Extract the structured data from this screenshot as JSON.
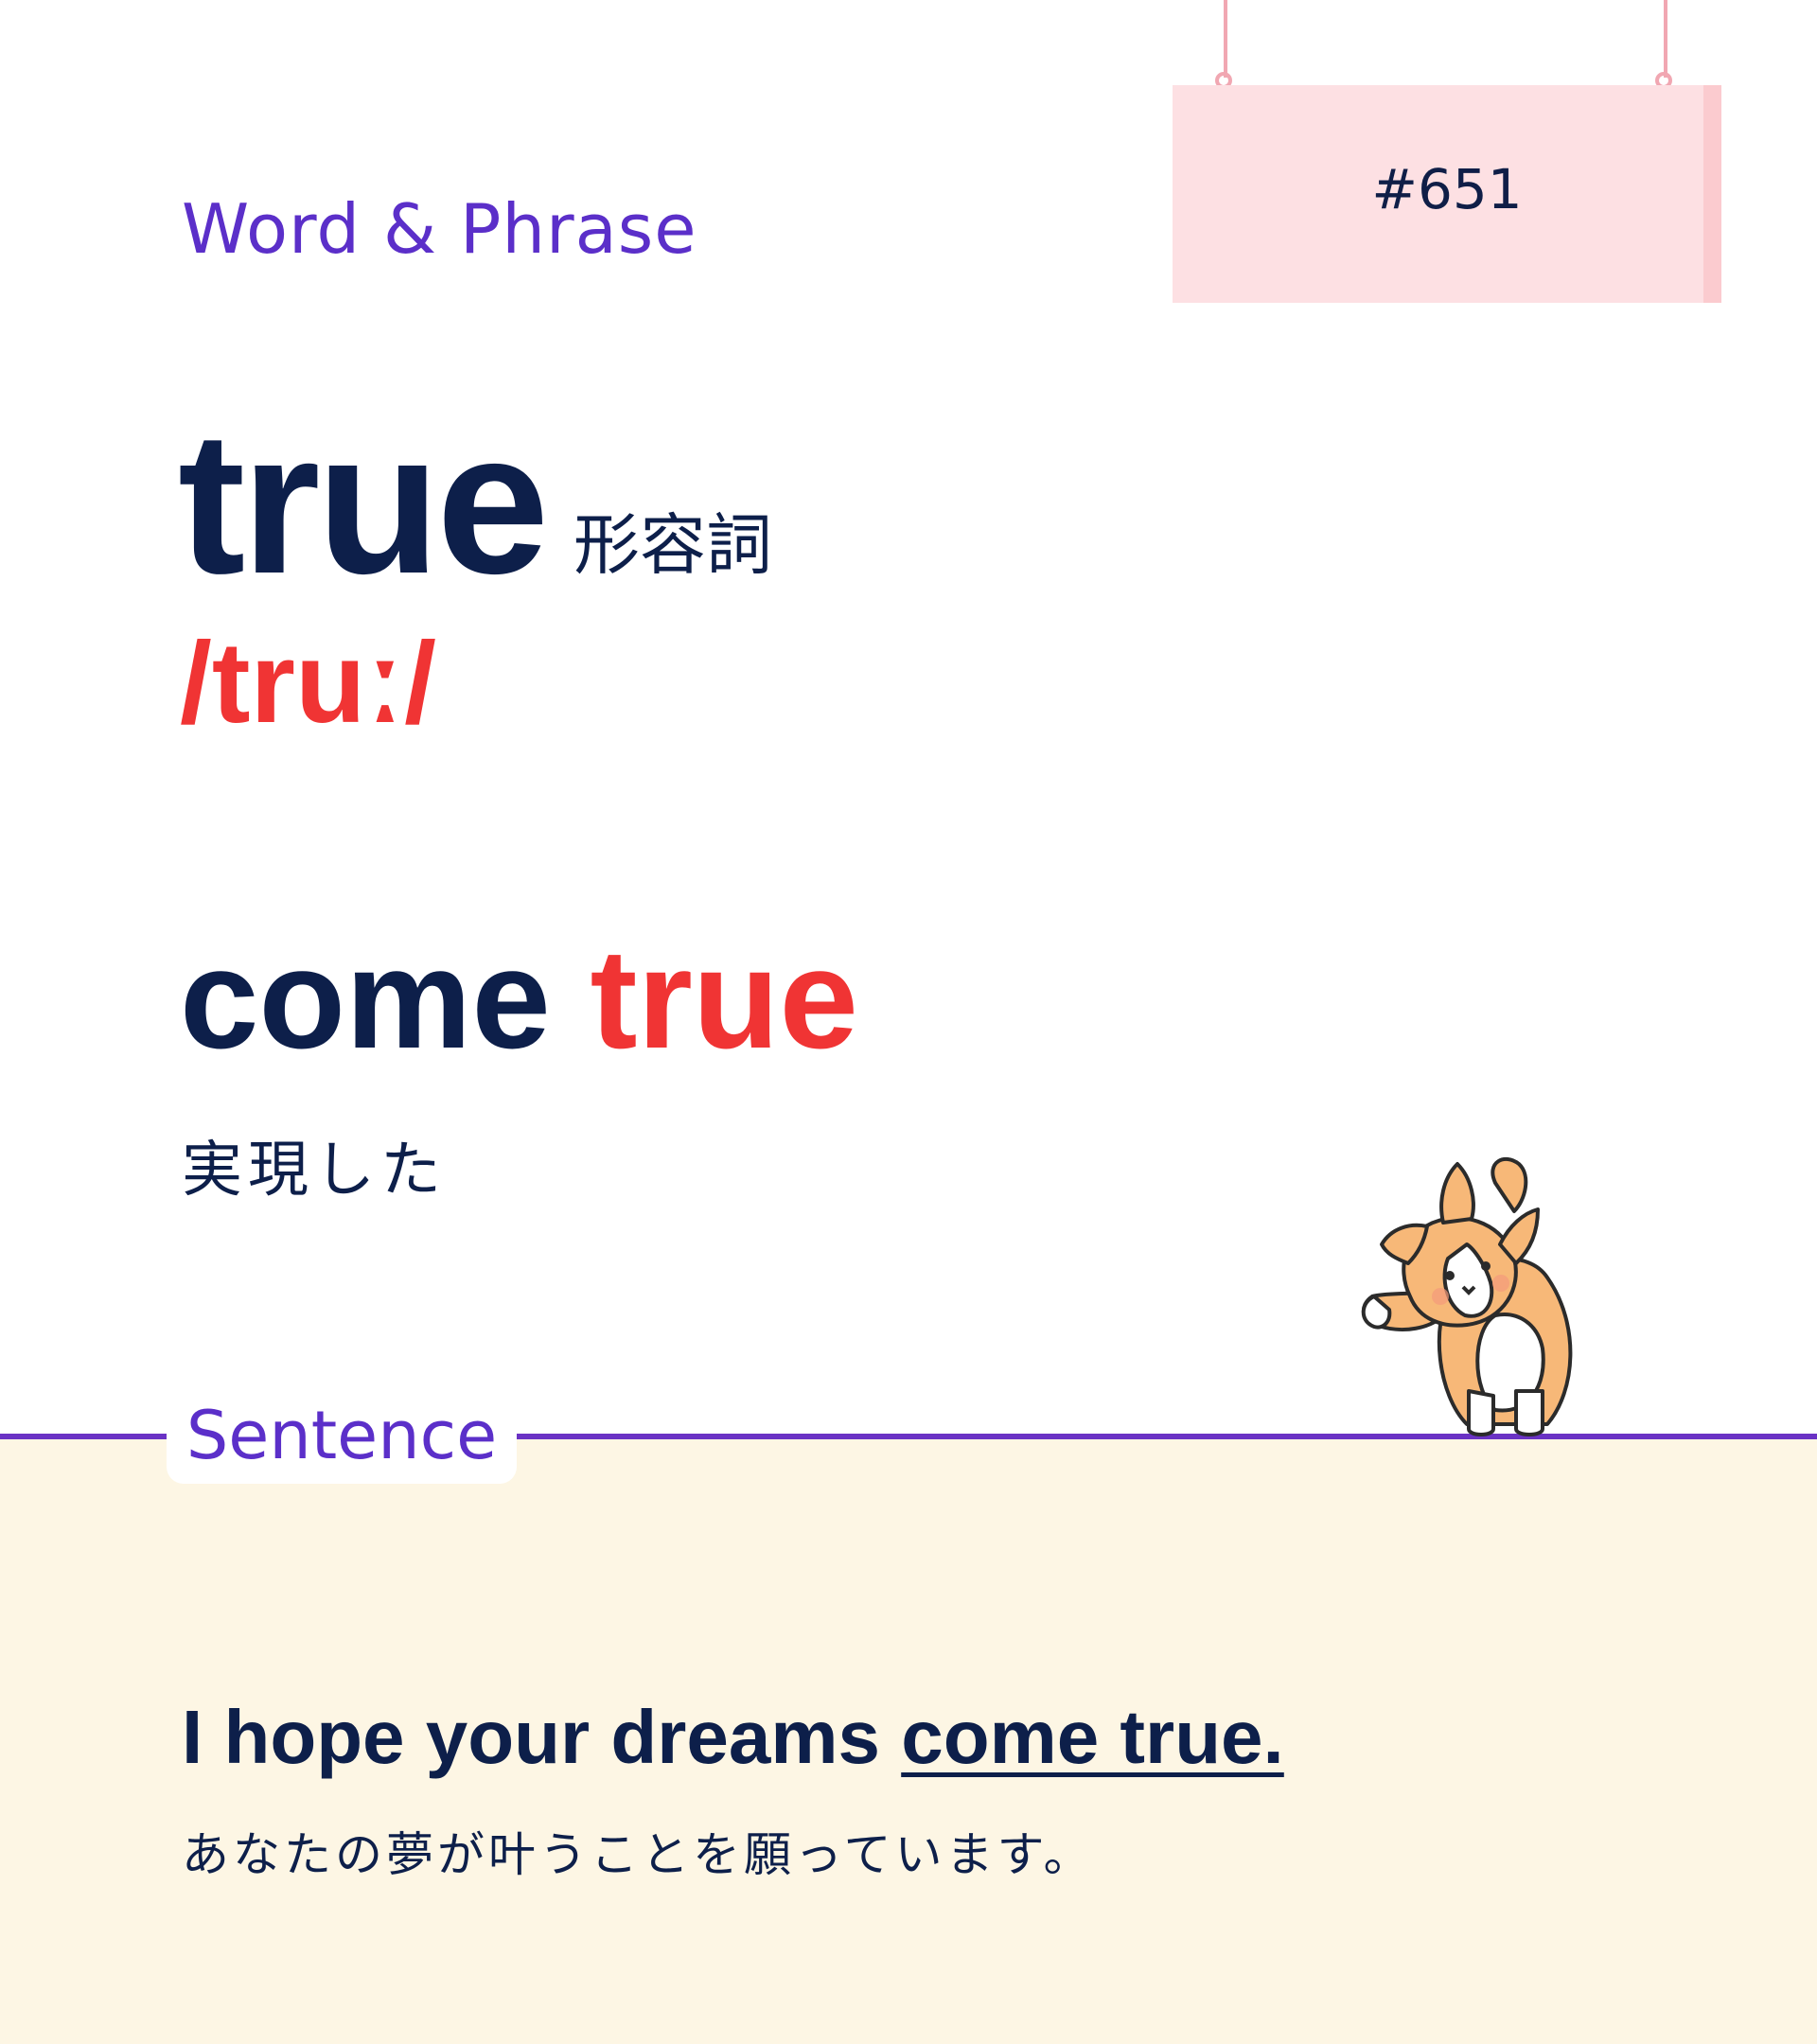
{
  "header": {
    "category": "Word & Phrase",
    "card_number": "#651"
  },
  "word": {
    "headword": "true",
    "part_of_speech": "形容詞",
    "pronunciation": "/truː/"
  },
  "phrase": {
    "prefix": "come",
    "highlight": "true",
    "meaning": "実現した"
  },
  "sentence_section": {
    "label": "Sentence",
    "before": "I hope your dreams ",
    "underlined": "come true.",
    "translation": "あなたの夢が叶うことを願っています。"
  },
  "colors": {
    "navy": "#0d1f4a",
    "accent_red": "#f03434",
    "purple": "#5b2fc9",
    "sign_pink": "#fde0e3",
    "sentence_bg": "#fdf6e4"
  },
  "icons": {
    "mascot": "corgi-icon"
  }
}
